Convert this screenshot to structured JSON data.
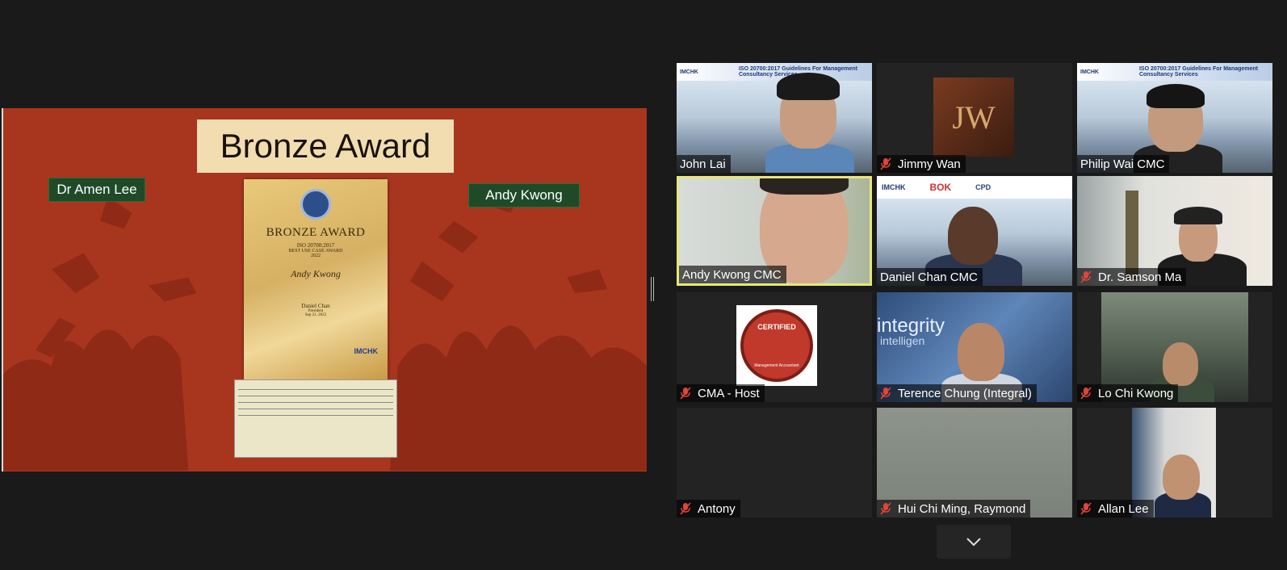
{
  "share": {
    "title": "Bronze Award",
    "left_name": "Dr Amen Lee",
    "right_name": "Andy Kwong",
    "certificate": {
      "heading": "BRONZE AWARD",
      "standard": "ISO 20700:2017",
      "category": "BEST USE CASE AWARD",
      "year": "2022",
      "recipient": "Andy Kwong",
      "signatory": "Daniel Chan",
      "signatory_title": "President",
      "date": "Sep 21, 2022",
      "logo": "IMCHK"
    }
  },
  "participants": [
    {
      "name": "John Lai",
      "muted": false,
      "active": false
    },
    {
      "name": "Jimmy Wan",
      "muted": true,
      "active": false
    },
    {
      "name": "Philip Wai CMC",
      "muted": false,
      "active": false
    },
    {
      "name": "Andy Kwong CMC",
      "muted": false,
      "active": true
    },
    {
      "name": "Daniel Chan CMC",
      "muted": false,
      "active": false
    },
    {
      "name": "Dr. Samson Ma",
      "muted": true,
      "active": false
    },
    {
      "name": "CMA - Host",
      "muted": true,
      "active": false
    },
    {
      "name": "Terence Chung (Integral)",
      "muted": true,
      "active": false
    },
    {
      "name": "Lo Chi Kwong",
      "muted": true,
      "active": false
    },
    {
      "name": "Antony",
      "muted": true,
      "active": false
    },
    {
      "name": "Hui Chi Ming, Raymond",
      "muted": true,
      "active": false
    },
    {
      "name": "Allan Lee",
      "muted": true,
      "active": false
    }
  ],
  "tiles_content": {
    "jw_logo": "JW",
    "cma_badge": "CERTIFIED",
    "cma_badge_sub": "Management Accountant",
    "integrity_text": "integrity",
    "intelligence_text": "intelligen",
    "banner_imchk": "IMCHK",
    "banner_text": "ISO 20700:2017 Guidelines For Management Consultancy Services",
    "bok_text": "BOK",
    "cpd_text": "CPD"
  },
  "colors": {
    "background": "#1a1a1a",
    "share_background": "#a8361f",
    "active_speaker_border": "#e7e77a",
    "mute_icon": "#e0453a"
  },
  "icons": {
    "mute": "mic-off-icon",
    "more": "chevron-down-icon"
  }
}
